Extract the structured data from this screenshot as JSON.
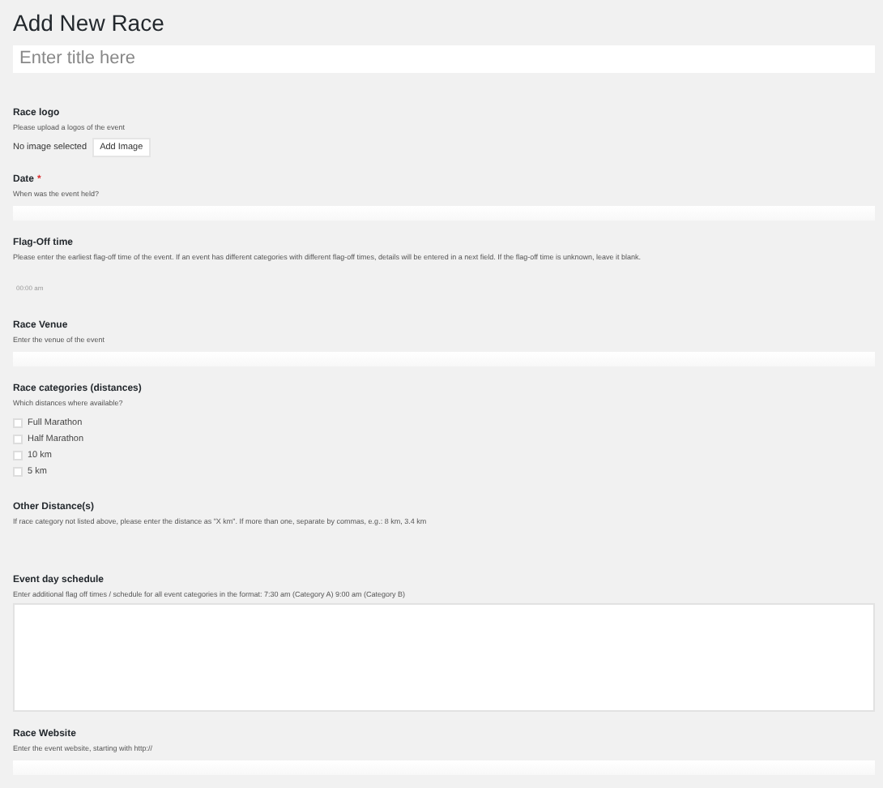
{
  "page_title": "Add New Race",
  "title_field": {
    "placeholder": "Enter title here"
  },
  "fields": [
    {
      "kind": "image",
      "label": "Race logo",
      "description": "Please upload a logos of the event",
      "status": "No image selected",
      "button": "Add Image"
    },
    {
      "kind": "text",
      "label": "Date",
      "required_mark": "*",
      "description": "When was the event held?"
    },
    {
      "kind": "time",
      "label": "Flag-Off time",
      "description": "Please enter the earliest flag-off time of the event. If an event has different categories with different flag-off times, details will be entered in a next field. If the flag-off time is unknown, leave it blank.",
      "placeholder": "00:00 am"
    },
    {
      "kind": "text",
      "label": "Race Venue",
      "description": "Enter the venue of the event"
    },
    {
      "kind": "checkboxes",
      "label": "Race categories (distances)",
      "description": "Which distances where available?",
      "options": [
        {
          "label": "Full Marathon",
          "checked": false
        },
        {
          "label": "Half Marathon",
          "checked": false
        },
        {
          "label": "10 km",
          "checked": false
        },
        {
          "label": "5 km",
          "checked": false
        }
      ]
    },
    {
      "kind": "blank",
      "label": "Other Distance(s)",
      "description": "If race category not listed above, please enter the distance as \"X km\". If more than one, separate by commas, e.g.: 8 km, 3.4 km"
    },
    {
      "kind": "textarea",
      "label": "Event day schedule",
      "description": "Enter additional flag off times / schedule for all event categories in the format: 7:30 am (Category A) 9:00 am (Category B)"
    },
    {
      "kind": "text",
      "label": "Race Website",
      "description": "Enter the event website, starting with http://"
    }
  ]
}
